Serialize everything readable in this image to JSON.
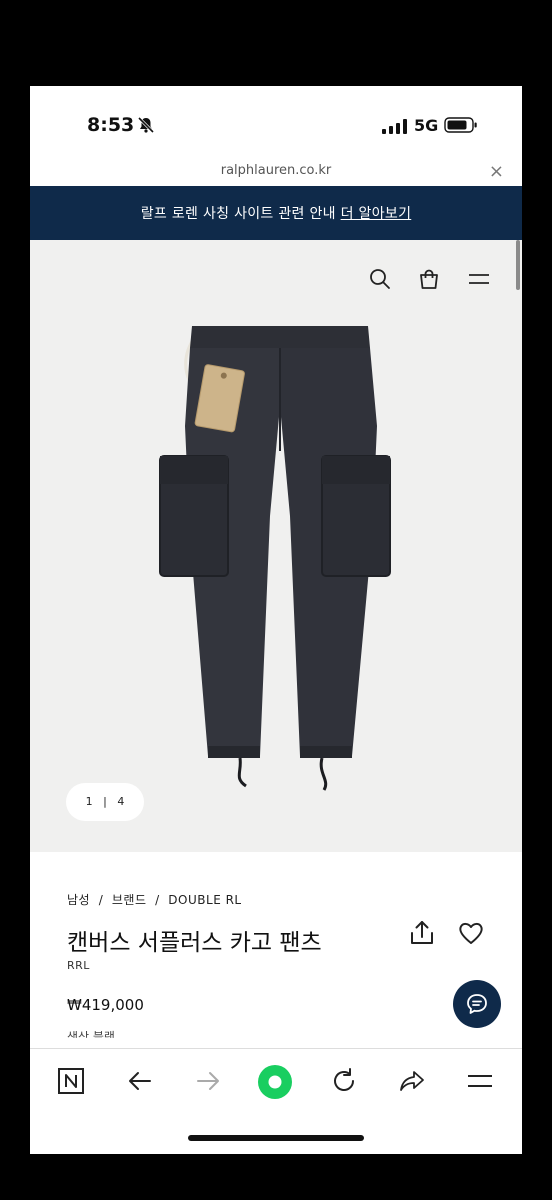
{
  "status": {
    "time": "8:53",
    "network": "5G"
  },
  "browser": {
    "url": "ralphlauren.co.kr",
    "close_icon": "×"
  },
  "banner": {
    "text": "랄프 로렌 사칭 사이트 관련 안내",
    "link": "더 알아보기",
    "bg": "#0f2a4a"
  },
  "header_icons": [
    "search-icon",
    "shopping-bag-icon",
    "menu-icon"
  ],
  "gallery": {
    "current": "1",
    "sep": "|",
    "total": "4"
  },
  "product": {
    "breadcrumb": "남성  /  브랜드  /  DOUBLE RL",
    "title": "캔버스 서플러스 카고 팬츠",
    "brand": "RRL",
    "price": "₩419,000",
    "truncated_text": "색상 블랙"
  },
  "toolbar_icons": [
    "naver-n-icon",
    "back-arrow-icon",
    "forward-arrow-icon",
    "green-dot-icon",
    "refresh-icon",
    "share-icon",
    "menu-icon"
  ],
  "colors": {
    "accent": "#0f2a4a",
    "green": "#19ce60",
    "hero_bg": "#f0f0ef"
  }
}
